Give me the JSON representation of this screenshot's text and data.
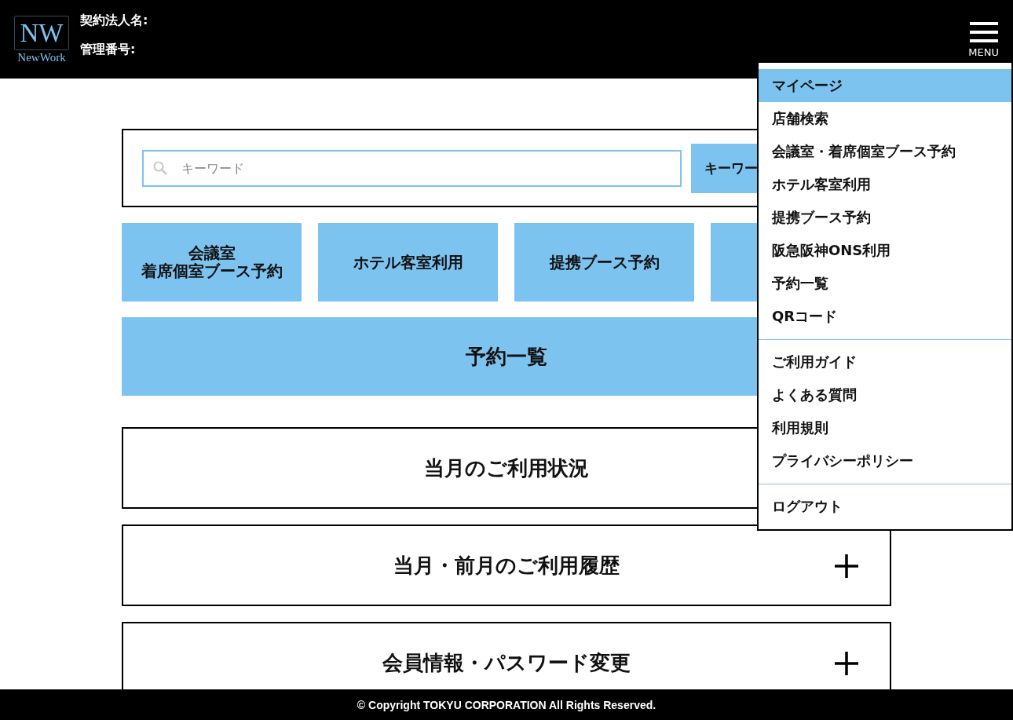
{
  "header": {
    "logo": {
      "mark": "NW",
      "name": "NewWork"
    },
    "fields": [
      {
        "label": "契約法人名:"
      },
      {
        "label": "管理番号:"
      }
    ],
    "menu_label": "MENU"
  },
  "search": {
    "placeholder": "キーワード",
    "button": "キーワー"
  },
  "quick_buttons": [
    {
      "kind": "label",
      "lines": [
        "会議室",
        "着席個室ブース予約"
      ]
    },
    {
      "kind": "label",
      "lines": [
        "ホテル客室利用"
      ]
    },
    {
      "kind": "label",
      "lines": [
        "提携ブース予約"
      ]
    },
    {
      "kind": "covered"
    }
  ],
  "wide_button": "予約一覧",
  "accordions": [
    {
      "title": "当月のご利用状況"
    },
    {
      "title": "当月・前月のご利用履歴",
      "plus_icon": true
    },
    {
      "title": "会員情報・パスワード変更",
      "plus_icon": true
    }
  ],
  "menu": {
    "groups": [
      [
        {
          "label": "マイページ",
          "selected": true
        },
        {
          "label": "店舗検索",
          "selected": false
        },
        {
          "label": "会議室・着席個室ブース予約",
          "selected": false
        },
        {
          "label": "ホテル客室利用",
          "selected": false
        },
        {
          "label": "提携ブース予約",
          "selected": false
        },
        {
          "label": "阪急阪神ONS利用",
          "selected": false
        },
        {
          "label": "予約一覧",
          "selected": false
        },
        {
          "label": "QRコード",
          "selected": false
        }
      ],
      [
        {
          "label": "ご利用ガイド",
          "selected": false
        },
        {
          "label": "よくある質問",
          "selected": false
        },
        {
          "label": "利用規則",
          "selected": false
        },
        {
          "label": "プライバシーポリシー",
          "selected": false
        }
      ],
      [
        {
          "label": "ログアウト",
          "selected": false
        }
      ]
    ]
  },
  "footer": "© Copyright TOKYU CORPORATION All Rights Reserved."
}
